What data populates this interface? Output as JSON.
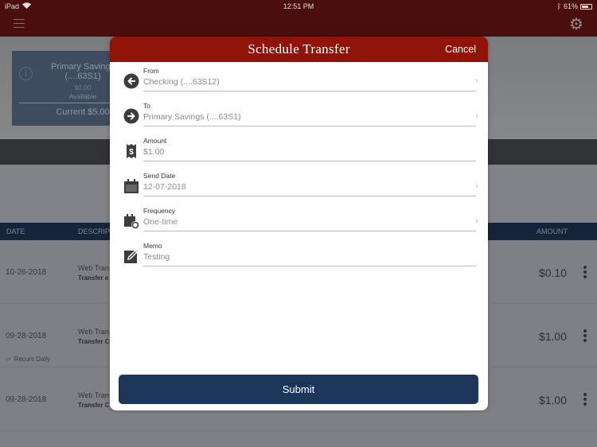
{
  "status_bar": {
    "device": "iPad",
    "time": "12:51 PM",
    "battery": "61%",
    "battery_level": 0.61
  },
  "app_header": {
    "menu_icon": "hamburger-menu-icon",
    "settings_icon": "gear-icon"
  },
  "account_card": {
    "name": "Primary Savings",
    "number": "(....63S1)",
    "available_balance": "$0.00",
    "available_label": "Available",
    "current": "Current $5.00"
  },
  "table": {
    "headers": {
      "date": "DATE",
      "description": "DESCRIP",
      "amount": "AMOUNT"
    },
    "rows": [
      {
        "date": "10-26-2018",
        "desc1": "Web Tran",
        "desc2": "Transfer e",
        "amount": "$0.10",
        "recurs": ""
      },
      {
        "date": "09-28-2018",
        "desc1": "Web Tran",
        "desc2": "Transfer C",
        "amount": "$1.00",
        "recurs": "Recurs Daily"
      },
      {
        "date": "09-28-2018",
        "desc1": "Web Tran",
        "desc2": "Transfer C",
        "amount": "$1.00",
        "recurs": ""
      }
    ]
  },
  "modal": {
    "title": "Schedule Transfer",
    "cancel_label": "Cancel",
    "fields": {
      "from": {
        "label": "From",
        "value": "Checking (....63S12)",
        "icon": "arrow-left-circle-icon"
      },
      "to": {
        "label": "To",
        "value": "Primary Savings (....63S1)",
        "icon": "arrow-right-circle-icon"
      },
      "amount": {
        "label": "Amount",
        "value": "$1.00",
        "icon": "dollar-receipt-icon"
      },
      "send_date": {
        "label": "Send Date",
        "value": "12-07-2018",
        "icon": "calendar-icon"
      },
      "frequency": {
        "label": "Frequency",
        "value": "One-time",
        "icon": "calendar-repeat-icon"
      },
      "memo": {
        "label": "Memo",
        "value": "Testing",
        "icon": "edit-note-icon"
      }
    },
    "submit_label": "Submit"
  },
  "colors": {
    "header_red": "#8f1309",
    "submit_navy": "#1b3659",
    "table_header": "#16243a"
  }
}
